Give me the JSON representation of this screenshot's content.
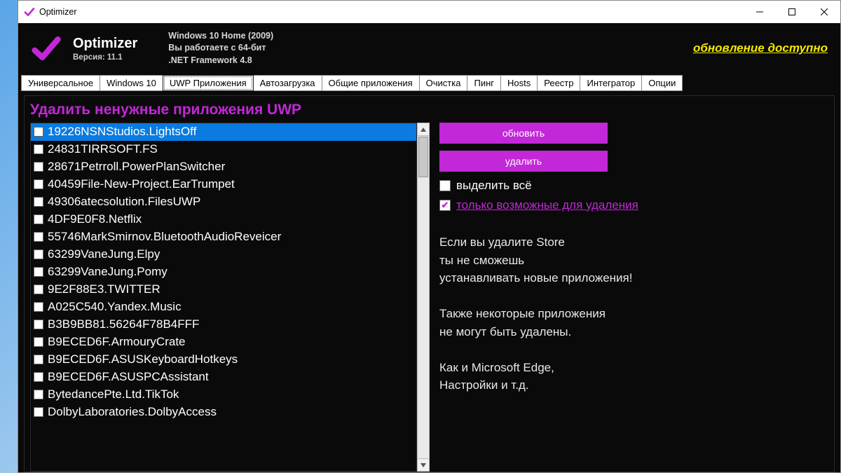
{
  "window": {
    "title": "Optimizer"
  },
  "header": {
    "app_name": "Optimizer",
    "version_label": "Версия: 11.1",
    "sys_line1": "Windows 10 Home (2009)",
    "sys_line2": "Вы работаете с 64-бит",
    "sys_line3": ".NET Framework 4.8",
    "update_link": "обновление доступно"
  },
  "tabs": [
    "Универсальное",
    "Windows 10",
    "UWP Приложения",
    "Автозагрузка",
    "Общие приложения",
    "Очистка",
    "Пинг",
    "Hosts",
    "Реестр",
    "Интегратор",
    "Опции"
  ],
  "active_tab_index": 2,
  "section_title": "Удалить ненужные приложения UWP",
  "apps": [
    "19226NSNStudios.LightsOff",
    "24831TIRRSOFT.FS",
    "28671Petrroll.PowerPlanSwitcher",
    "40459File-New-Project.EarTrumpet",
    "49306atecsolution.FilesUWP",
    "4DF9E0F8.Netflix",
    "55746MarkSmirnov.BluetoothAudioReveicer",
    "63299VaneJung.Elpy",
    "63299VaneJung.Pomy",
    "9E2F88E3.TWITTER",
    "A025C540.Yandex.Music",
    "B3B9BB81.56264F78B4FFF",
    "B9ECED6F.ArmouryCrate",
    "B9ECED6F.ASUSKeyboardHotkeys",
    "B9ECED6F.ASUSPCAssistant",
    "BytedancePte.Ltd.TikTok",
    "DolbyLaboratories.DolbyAccess"
  ],
  "selected_index": 0,
  "actions": {
    "refresh": "обновить",
    "delete": "удалить",
    "select_all": "выделить всё",
    "only_removable": "только возможные для удаления"
  },
  "info": {
    "l1": "Если вы удалите Store",
    "l2": "ты не сможешь",
    "l3": "устанавливать новые приложения!",
    "l4": "Также некоторые приложения",
    "l5": "не могут быть удалены.",
    "l6": "Как и Microsoft Edge,",
    "l7": "Настройки и т.д."
  }
}
